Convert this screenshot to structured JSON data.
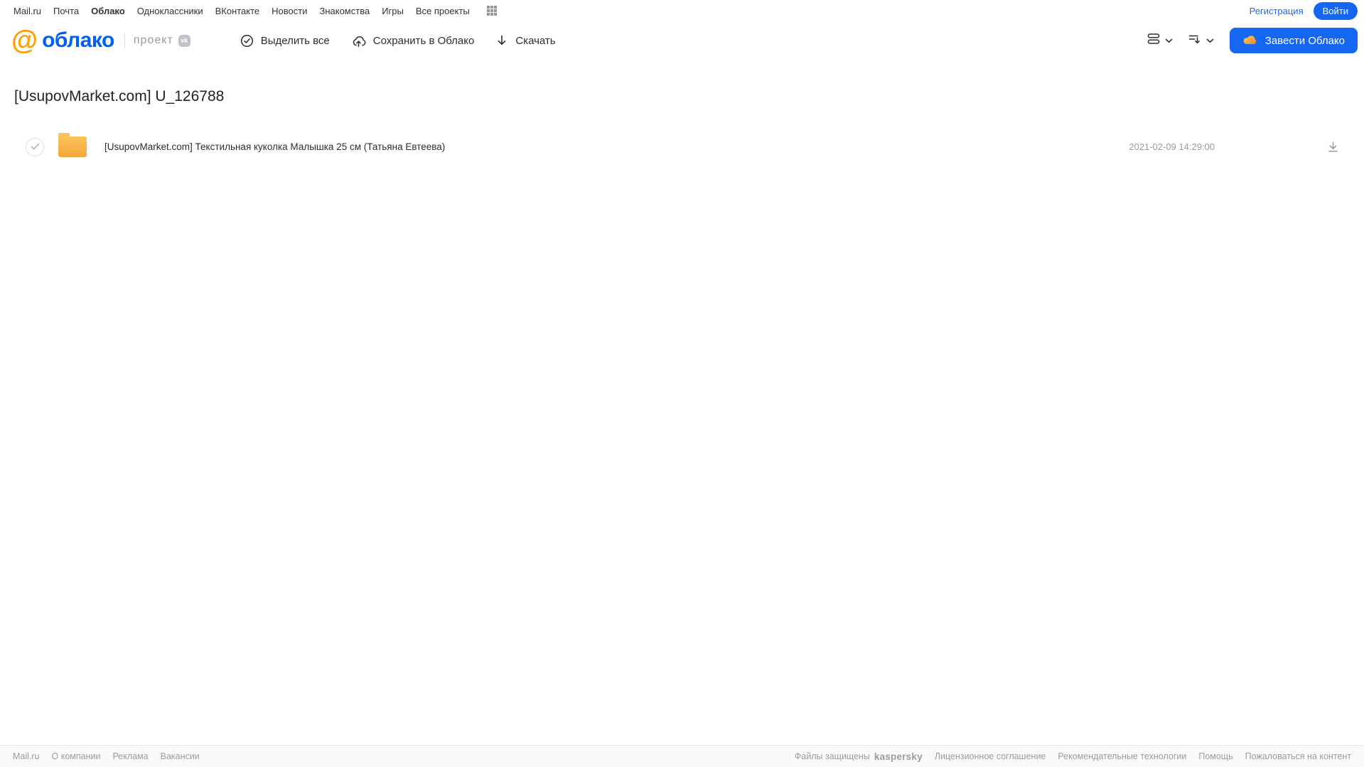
{
  "topnav": {
    "items": [
      "Mail.ru",
      "Почта",
      "Облако",
      "Одноклассники",
      "ВКонтакте",
      "Новости",
      "Знакомства",
      "Игры",
      "Все проекты"
    ],
    "active_item": "Облако",
    "registration_label": "Регистрация",
    "login_label": "Войти"
  },
  "header": {
    "logo_at": "@",
    "logo_word": "облако",
    "project_label": "проект",
    "project_badge": "vk",
    "toolbar": {
      "select_all_label": "Выделить все",
      "save_to_cloud_label": "Сохранить в Облако",
      "download_label": "Скачать"
    },
    "get_cloud_label": "Завести Облако"
  },
  "main": {
    "title": "[UsupovMarket.com] U_126788",
    "files": [
      {
        "type": "folder",
        "name": "[UsupovMarket.com] Текстильная куколка Малышка 25 см (Татьяна Евтеева)",
        "modified": "2021-02-09 14:29:00"
      }
    ]
  },
  "footer": {
    "left_links": [
      "Mail.ru",
      "О компании",
      "Реклама",
      "Вакансии"
    ],
    "protected_label": "Файлы защищены",
    "protected_brand": "kaspersky",
    "right_links": [
      "Лицензионное соглашение",
      "Рекомендательные технологии",
      "Помощь",
      "Пожаловаться на контент"
    ]
  },
  "colors": {
    "accent_blue": "#1566f0",
    "link_blue": "#1b6bf2",
    "logo_blue": "#005ff9",
    "logo_orange": "#ff9e00",
    "folder_orange": "#f4a63a",
    "kaspersky_green": "#00a88e"
  }
}
